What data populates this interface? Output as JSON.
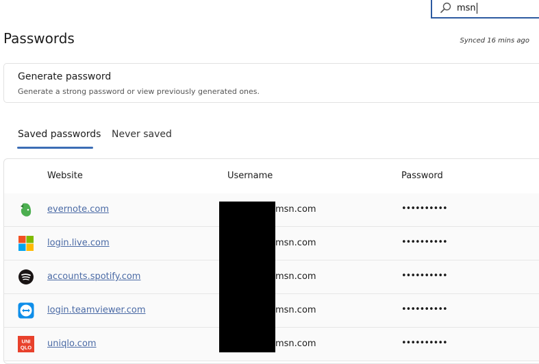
{
  "search": {
    "value": "msn"
  },
  "page": {
    "title": "Passwords",
    "synced": "Synced 16 mins ago"
  },
  "generate": {
    "title": "Generate password",
    "description": "Generate a strong password or view previously generated ones."
  },
  "tabs": [
    {
      "label": "Saved passwords",
      "selected": true
    },
    {
      "label": "Never saved",
      "selected": false
    }
  ],
  "table": {
    "headers": {
      "website": "Website",
      "username": "Username",
      "password": "Password"
    },
    "rows": [
      {
        "icon": "evernote-icon",
        "site": "evernote.com",
        "user": "msn.com",
        "password": "••••••••••"
      },
      {
        "icon": "microsoft-icon",
        "site": "login.live.com",
        "user": "msn.com",
        "password": "••••••••••"
      },
      {
        "icon": "spotify-icon",
        "site": "accounts.spotify.com",
        "user": "msn.com",
        "password": "••••••••••"
      },
      {
        "icon": "teamviewer-icon",
        "site": "login.teamviewer.com",
        "user": "msn.com",
        "password": "••••••••••"
      },
      {
        "icon": "uniqlo-icon",
        "site": "uniqlo.com",
        "user": "msn.com",
        "password": "••••••••••",
        "logo_text": [
          "UNI",
          "QLO"
        ]
      }
    ]
  },
  "colors": {
    "accent": "#3b6db5",
    "link": "#4a6aa5",
    "search_border": "#2c5aa0"
  }
}
